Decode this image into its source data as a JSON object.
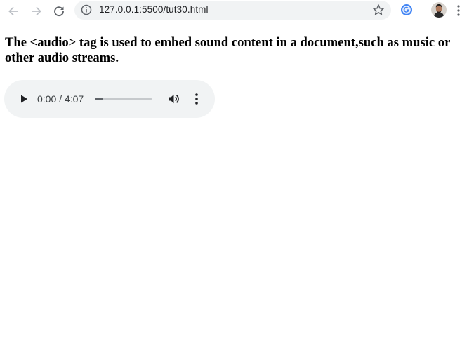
{
  "browser": {
    "url": "127.0.0.1:5500/tut30.html",
    "icons": {
      "back": "arrow-left-icon",
      "forward": "arrow-right-icon",
      "reload": "reload-icon",
      "info": "info-icon",
      "bookmark": "star-icon",
      "extension": "google-extension-icon",
      "profile": "avatar",
      "menu": "kebab-menu-icon"
    }
  },
  "page": {
    "heading": "The <audio> tag is used to embed sound content in a document,such as music or other audio streams."
  },
  "audio_player": {
    "time": "0:00 / 4:07",
    "progress": 0,
    "buffered_fraction": 0.15,
    "colors": {
      "background": "#f1f3f4",
      "icon": "#202124",
      "track": "#c6c9cc",
      "buffered": "#5f6368"
    }
  }
}
